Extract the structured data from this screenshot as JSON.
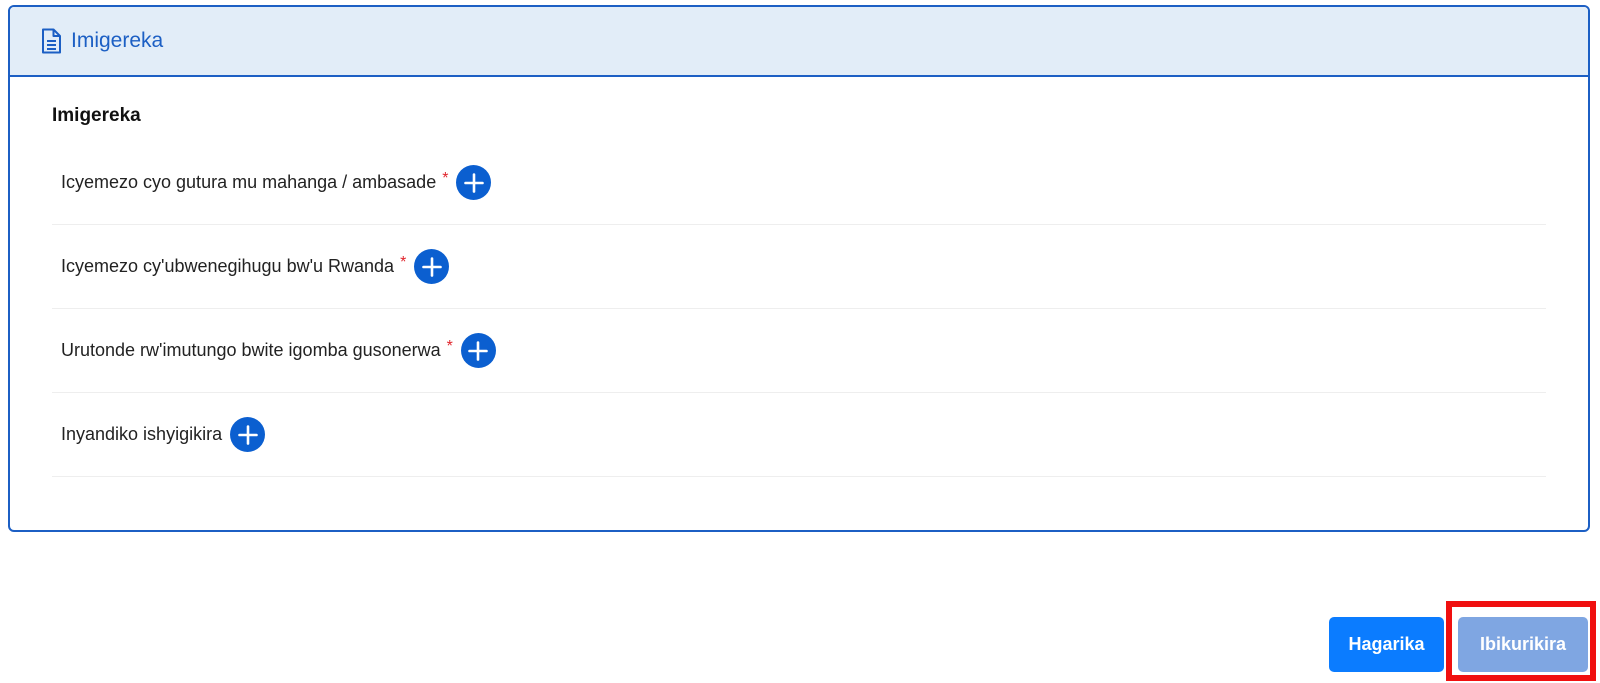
{
  "panel": {
    "header_title": "Imigereka",
    "header_icon": "document-icon",
    "section_title": "Imigereka"
  },
  "documents": [
    {
      "label": "Icyemezo cyo gutura mu mahanga / ambasade",
      "required": true,
      "required_mark": "*"
    },
    {
      "label": "Icyemezo cy'ubwenegihugu bw'u Rwanda",
      "required": true,
      "required_mark": "*"
    },
    {
      "label": "Urutonde rw'imutungo bwite igomba gusonerwa",
      "required": true,
      "required_mark": "*"
    },
    {
      "label": "Inyandiko ishyigikira",
      "required": false,
      "required_mark": ""
    }
  ],
  "actions": {
    "cancel_label": "Hagarika",
    "next_label": "Ibikurikira"
  },
  "colors": {
    "accent": "#1c5fc4",
    "header_bg": "#e2edf8",
    "add_button": "#0b5fd0",
    "cancel_button": "#0b7cff",
    "next_button": "#7fa6e2",
    "required": "#e0242b",
    "highlight": "#f00f0f"
  }
}
